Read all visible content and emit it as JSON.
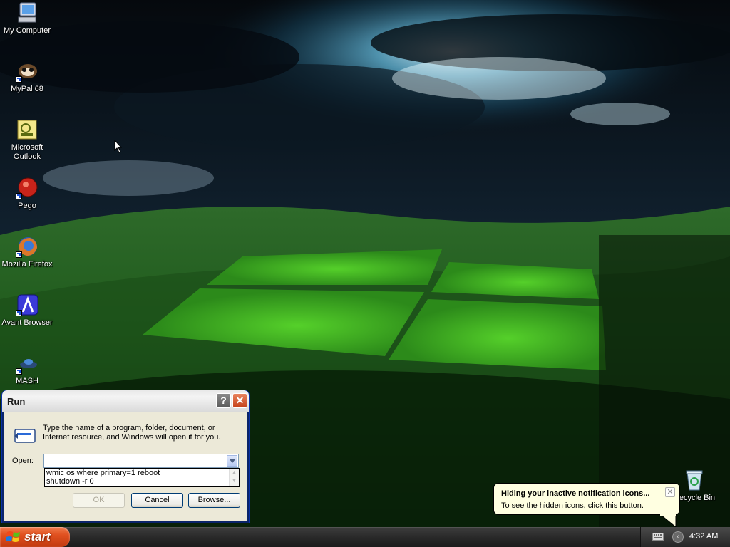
{
  "desktop": {
    "icons": [
      {
        "label": "My Computer"
      },
      {
        "label": "MyPal 68"
      },
      {
        "label": "Microsoft Outlook"
      },
      {
        "label": "Pego"
      },
      {
        "label": "Mozilla Firefox"
      },
      {
        "label": "Avant Browser"
      },
      {
        "label": "MASH"
      }
    ],
    "recycle_bin": {
      "label": "Recycle Bin"
    }
  },
  "run_dialog": {
    "title": "Run",
    "help_glyph": "?",
    "close_glyph": "✕",
    "description": "Type the name of a program, folder, document, or Internet resource, and Windows will open it for you.",
    "open_label": "Open:",
    "open_value": "",
    "history": [
      "wmic os where primary=1 reboot",
      "shutdown -r 0"
    ],
    "ok_label": "OK",
    "cancel_label": "Cancel",
    "browse_label": "Browse..."
  },
  "notification": {
    "title": "Hiding your inactive notification icons...",
    "text": "To see the hidden icons, click this button."
  },
  "taskbar": {
    "start_label": "start",
    "clock": "4:32 AM",
    "show_hidden_glyph": "‹"
  },
  "colors": {
    "start_button": "#e0501f",
    "balloon_bg": "#ffffe1",
    "dialog_face": "#ece9d8",
    "taskbar": "#2a2a2a"
  }
}
